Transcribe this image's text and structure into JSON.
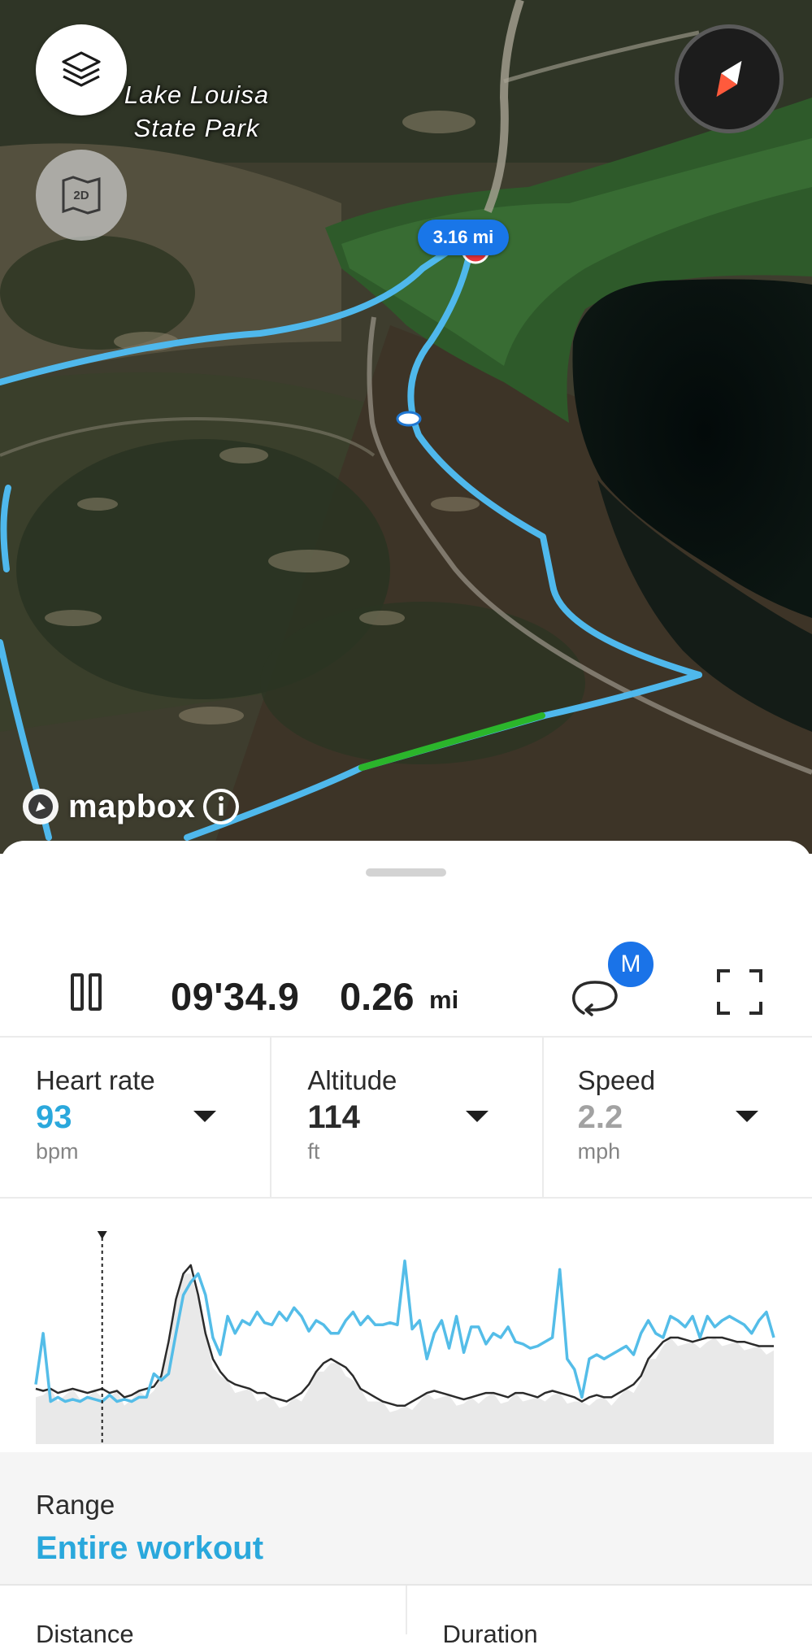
{
  "map": {
    "place_label_line1": "Lake Louisa",
    "place_label_line2": "State Park",
    "distance_badge": "3.16 mi",
    "attribution": "mapbox",
    "layers_icon": "layers-icon",
    "view_toggle_label": "2D",
    "compass_icon": "compass-icon",
    "route_color": "#4fb8ec",
    "fast_segment_color": "#2bb52b"
  },
  "playback": {
    "time": "09'34.9",
    "distance": "0.26",
    "distance_unit": "mi",
    "lap_badge": "M",
    "pause_icon": "pause-icon",
    "lap_icon": "lap-loop-icon",
    "fullscreen_icon": "fullscreen-icon"
  },
  "metrics": [
    {
      "label": "Heart rate",
      "value": "93",
      "unit": "bpm",
      "color": "#2aa8dc"
    },
    {
      "label": "Altitude",
      "value": "114",
      "unit": "ft",
      "color": "#2b2b2b"
    },
    {
      "label": "Speed",
      "value": "2.2",
      "unit": "mph",
      "color": "#a2a2a2"
    }
  ],
  "chart_data": {
    "type": "line",
    "title": "",
    "xlabel": "",
    "ylabel": "",
    "x_range": [
      0,
      100
    ],
    "y_range": [
      0,
      100
    ],
    "grid": false,
    "playhead_x": 9,
    "series": [
      {
        "name": "Heart rate",
        "color": "#54bde8",
        "x": [
          0,
          1,
          2,
          3,
          4,
          5,
          6,
          7,
          8,
          9,
          10,
          11,
          12,
          13,
          14,
          15,
          16,
          17,
          18,
          19,
          20,
          21,
          22,
          23,
          24,
          25,
          26,
          27,
          28,
          29,
          30,
          31,
          32,
          33,
          34,
          35,
          36,
          37,
          38,
          39,
          40,
          41,
          42,
          43,
          44,
          45,
          46,
          47,
          48,
          49,
          50,
          51,
          52,
          53,
          54,
          55,
          56,
          57,
          58,
          59,
          60,
          61,
          62,
          63,
          64,
          65,
          66,
          67,
          68,
          69,
          70,
          71,
          72,
          73,
          74,
          75,
          76,
          77,
          78,
          79,
          80,
          81,
          82,
          83,
          84,
          85,
          86,
          87,
          88,
          89,
          90,
          91,
          92,
          93,
          94,
          95,
          96,
          97,
          98,
          99,
          100
        ],
        "values": [
          28,
          52,
          20,
          22,
          20,
          21,
          20,
          22,
          21,
          20,
          23,
          20,
          21,
          20,
          22,
          22,
          33,
          30,
          33,
          52,
          70,
          76,
          80,
          70,
          50,
          42,
          60,
          52,
          58,
          56,
          62,
          57,
          56,
          62,
          58,
          64,
          60,
          53,
          58,
          56,
          52,
          52,
          58,
          62,
          56,
          60,
          56,
          56,
          57,
          56,
          86,
          54,
          58,
          40,
          52,
          58,
          45,
          60,
          43,
          55,
          55,
          47,
          52,
          50,
          55,
          48,
          47,
          45,
          46,
          48,
          50,
          82,
          40,
          35,
          22,
          40,
          42,
          40,
          42,
          44,
          46,
          42,
          52,
          58,
          52,
          50,
          60,
          58,
          55,
          60,
          50,
          60,
          55,
          58,
          60,
          58,
          56,
          52,
          58,
          62,
          50
        ]
      },
      {
        "name": "Altitude",
        "color": "#2b2b2b",
        "x": [
          0,
          1,
          2,
          3,
          4,
          5,
          6,
          7,
          8,
          9,
          10,
          11,
          12,
          13,
          14,
          15,
          16,
          17,
          18,
          19,
          20,
          21,
          22,
          23,
          24,
          25,
          26,
          27,
          28,
          29,
          30,
          31,
          32,
          33,
          34,
          35,
          36,
          37,
          38,
          39,
          40,
          41,
          42,
          43,
          44,
          45,
          46,
          47,
          48,
          49,
          50,
          51,
          52,
          53,
          54,
          55,
          56,
          57,
          58,
          59,
          60,
          61,
          62,
          63,
          64,
          65,
          66,
          67,
          68,
          69,
          70,
          71,
          72,
          73,
          74,
          75,
          76,
          77,
          78,
          79,
          80,
          81,
          82,
          83,
          84,
          85,
          86,
          87,
          88,
          89,
          90,
          91,
          92,
          93,
          94,
          95,
          96,
          97,
          98,
          99,
          100
        ],
        "values": [
          26,
          25,
          26,
          24,
          25,
          26,
          25,
          24,
          25,
          26,
          24,
          25,
          22,
          23,
          25,
          26,
          27,
          32,
          48,
          68,
          80,
          84,
          70,
          52,
          40,
          34,
          30,
          28,
          27,
          26,
          24,
          24,
          22,
          21,
          20,
          22,
          24,
          28,
          34,
          38,
          40,
          38,
          36,
          32,
          26,
          24,
          22,
          20,
          19,
          18,
          18,
          20,
          22,
          24,
          25,
          24,
          23,
          22,
          21,
          22,
          23,
          24,
          24,
          23,
          22,
          24,
          24,
          23,
          22,
          24,
          25,
          24,
          23,
          22,
          20,
          22,
          23,
          22,
          22,
          24,
          26,
          28,
          32,
          40,
          44,
          48,
          50,
          50,
          49,
          48,
          49,
          50,
          50,
          50,
          49,
          48,
          48,
          47,
          46,
          46,
          46
        ]
      }
    ]
  },
  "range": {
    "label": "Range",
    "value": "Entire workout"
  },
  "stats": [
    {
      "label": "Distance"
    },
    {
      "label": "Duration"
    }
  ]
}
